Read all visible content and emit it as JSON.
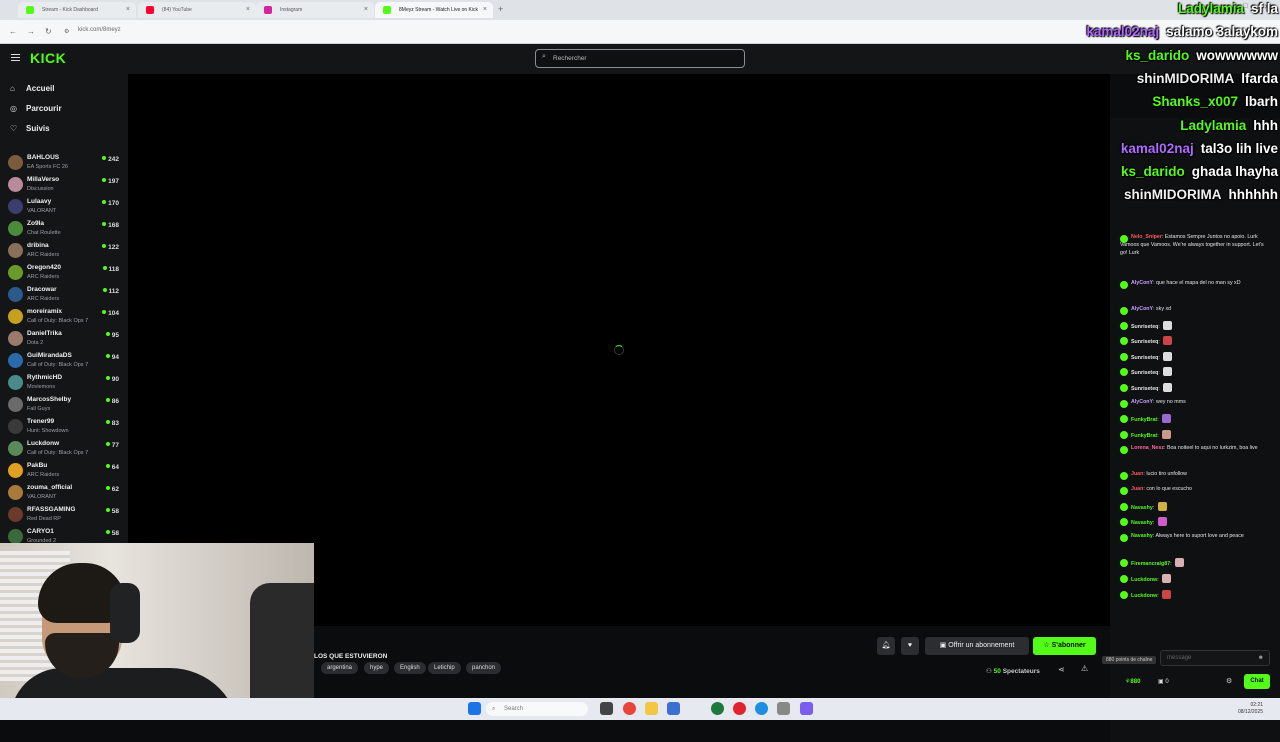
{
  "browser": {
    "tabs": [
      {
        "label": "Stream - Kick Dashboard",
        "color": "#53fc18"
      },
      {
        "label": "(84) YouTube",
        "color": "#ff0033"
      },
      {
        "label": "Instagram",
        "color": "#d6249f"
      },
      {
        "label": "8Meyz Stream - Watch Live on Kick",
        "color": "#53fc18"
      }
    ],
    "url": "kick.com/8meyz"
  },
  "app": {
    "logo": "KICK",
    "search_placeholder": "Rechercher",
    "nav": [
      {
        "label": "Accueil",
        "icon": "home-icon"
      },
      {
        "label": "Parcourir",
        "icon": "compass-icon"
      },
      {
        "label": "Suivis",
        "icon": "heart-icon"
      }
    ],
    "channels": [
      {
        "name": "BAHLOUS",
        "game": "EA Sports FC 26",
        "viewers": "242",
        "color": "#7a5c3c"
      },
      {
        "name": "MillaVerso",
        "game": "Discussion",
        "viewers": "197",
        "color": "#b88a9a"
      },
      {
        "name": "Lulaavy",
        "game": "VALORANT",
        "viewers": "170",
        "color": "#3a3f6e"
      },
      {
        "name": "Zo9la",
        "game": "Chat Roulette",
        "viewers": "168",
        "color": "#4a8c3a"
      },
      {
        "name": "dribina",
        "game": "ARC Raiders",
        "viewers": "122",
        "color": "#8a6f5a"
      },
      {
        "name": "Oregon420",
        "game": "ARC Raiders",
        "viewers": "118",
        "color": "#6a9a2a"
      },
      {
        "name": "Dracowar",
        "game": "ARC Raiders",
        "viewers": "112",
        "color": "#2a5a8a"
      },
      {
        "name": "moreiramix",
        "game": "Call of Duty: Black Ops 7",
        "viewers": "104",
        "color": "#c8a020"
      },
      {
        "name": "DanielTrika",
        "game": "Dota 2",
        "viewers": "95",
        "color": "#9a7a6a"
      },
      {
        "name": "GuiMirandaDS",
        "game": "Call of Duty: Black Ops 7",
        "viewers": "94",
        "color": "#2a6aaa"
      },
      {
        "name": "RythmicHD",
        "game": "Moviemons",
        "viewers": "90",
        "color": "#4a8a8a"
      },
      {
        "name": "MarcosShelby",
        "game": "Fall Guys",
        "viewers": "86",
        "color": "#6a6a6a"
      },
      {
        "name": "Trener99",
        "game": "Hunt: Showdown",
        "viewers": "83",
        "color": "#3a3a3a"
      },
      {
        "name": "Luckdonw",
        "game": "Call of Duty: Black Ops 7",
        "viewers": "77",
        "color": "#5a8a5a"
      },
      {
        "name": "PakBu",
        "game": "ARC Raiders",
        "viewers": "64",
        "color": "#e0a020"
      },
      {
        "name": "zouma_official",
        "game": "VALORANT",
        "viewers": "62",
        "color": "#aa7a3a"
      },
      {
        "name": "RFASSGAMING",
        "game": "Red Dead RP",
        "viewers": "58",
        "color": "#6a3a2a"
      },
      {
        "name": "CARYO1",
        "game": "Grounded 2",
        "viewers": "58",
        "color": "#3a6a3a"
      }
    ],
    "stream": {
      "title": "LOS QUE ESTUVIERON",
      "tags": [
        "argentina",
        "hype",
        "English",
        "Letichip",
        "panchon"
      ],
      "gift_label": "Offrir un abonnement",
      "subscribe_label": "S'abonner",
      "viewers_count": "50",
      "viewers_label": "Spectateurs"
    },
    "chat": {
      "messages": [
        {
          "user": "Nelo_Sniper",
          "text": "Estamos Sempre Juntos no apoio. Lurk Vamoos que Vamoos. We're always together in support. Let's go! Lurk",
          "color": "#ff5a5a"
        },
        {
          "user": "AlyConY",
          "text": "que hace el mapa del no man sy xD",
          "color": "#c8a0ff"
        },
        {
          "user": "AlyConY",
          "text": "sky xd",
          "color": "#c8a0ff"
        },
        {
          "user": "Sunriseteq",
          "text": "",
          "color": "#e6e6e6"
        },
        {
          "user": "Sunriseteq",
          "text": "",
          "color": "#e6e6e6"
        },
        {
          "user": "Sunriseteq",
          "text": "",
          "color": "#e6e6e6"
        },
        {
          "user": "Sunriseteq",
          "text": "",
          "color": "#e6e6e6"
        },
        {
          "user": "Sunriseteq",
          "text": "",
          "color": "#e6e6e6"
        },
        {
          "user": "AlyConY",
          "text": "wey no mms",
          "color": "#c8a0ff"
        },
        {
          "user": "FunkyBrat",
          "text": "",
          "color": "#53fc18"
        },
        {
          "user": "FunkyBrat",
          "text": "",
          "color": "#53fc18"
        },
        {
          "user": "Lorena_Nesz",
          "text": "Boa noiteel to aqui no lurkzim, boa live",
          "color": "#ff6a9a"
        },
        {
          "user": "Juan",
          "text": "lucio tiro unfollow",
          "color": "#ff5a5a"
        },
        {
          "user": "Juan",
          "text": "con lo que escucho",
          "color": "#ff5a5a"
        },
        {
          "user": "Navashy",
          "text": "",
          "color": "#53fc18"
        },
        {
          "user": "Navashy",
          "text": "",
          "color": "#53fc18"
        },
        {
          "user": "Navashy",
          "text": "Always here to suport love and peace",
          "color": "#53fc18"
        },
        {
          "user": "Firemancraig87",
          "text": "",
          "color": "#53fc18"
        },
        {
          "user": "Luckdonw",
          "text": "",
          "color": "#53fc18"
        },
        {
          "user": "Luckdonw",
          "text": "",
          "color": "#53fc18"
        }
      ],
      "input_placeholder": "message",
      "points": "880",
      "points_tooltip": "880 points de chaîne",
      "zero": "0",
      "chat_button": "Chat"
    }
  },
  "overlay_chat": [
    {
      "user": "Ladylamia",
      "text": "sf la",
      "color": "#53fc18"
    },
    {
      "user": "kamal02naj",
      "text": "salamo 3alaykom",
      "color": "#b06aff"
    },
    {
      "user": "ks_darido",
      "text": "wowwwwww",
      "color": "#53fc18"
    },
    {
      "user": "shinMIDORIMA",
      "text": "lfarda",
      "color": "#f0f0f0"
    },
    {
      "user": "Shanks_x007",
      "text": "lbarh",
      "color": "#53fc18"
    },
    {
      "user": "Ladylamia",
      "text": "hhh",
      "color": "#53fc18"
    },
    {
      "user": "kamal02naj",
      "text": "tal3o lih live",
      "color": "#b06aff"
    },
    {
      "user": "ks_darido",
      "text": "ghada lhayha",
      "color": "#53fc18"
    },
    {
      "user": "shinMIDORIMA",
      "text": "hhhhhh",
      "color": "#f0f0f0"
    }
  ],
  "taskbar": {
    "search_label": "Search",
    "time": "02:21",
    "date": "08/12/2025"
  }
}
